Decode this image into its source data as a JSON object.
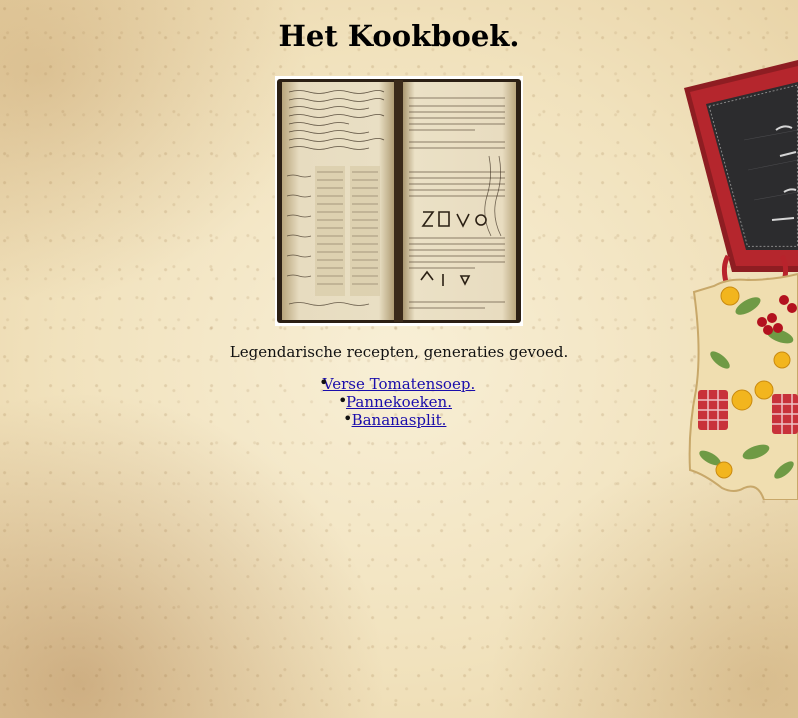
{
  "page": {
    "title": "Het Kookboek.",
    "tagline": "Legendarische recepten, generaties gevoed."
  },
  "recipes": [
    {
      "label": "Verse Tomatensoep."
    },
    {
      "label": "Pannekoeken."
    },
    {
      "label": "Bananasplit."
    }
  ],
  "colors": {
    "link": "#1a0dab",
    "chalkboard_frame": "#a5242a",
    "chalkboard": "#2c2c2e",
    "apron_check": "#c8323a",
    "parchment": "#f1e2bd"
  },
  "icons": {
    "book": "open-cookbook-image",
    "decoration": "chalkboard-and-apron-image"
  }
}
